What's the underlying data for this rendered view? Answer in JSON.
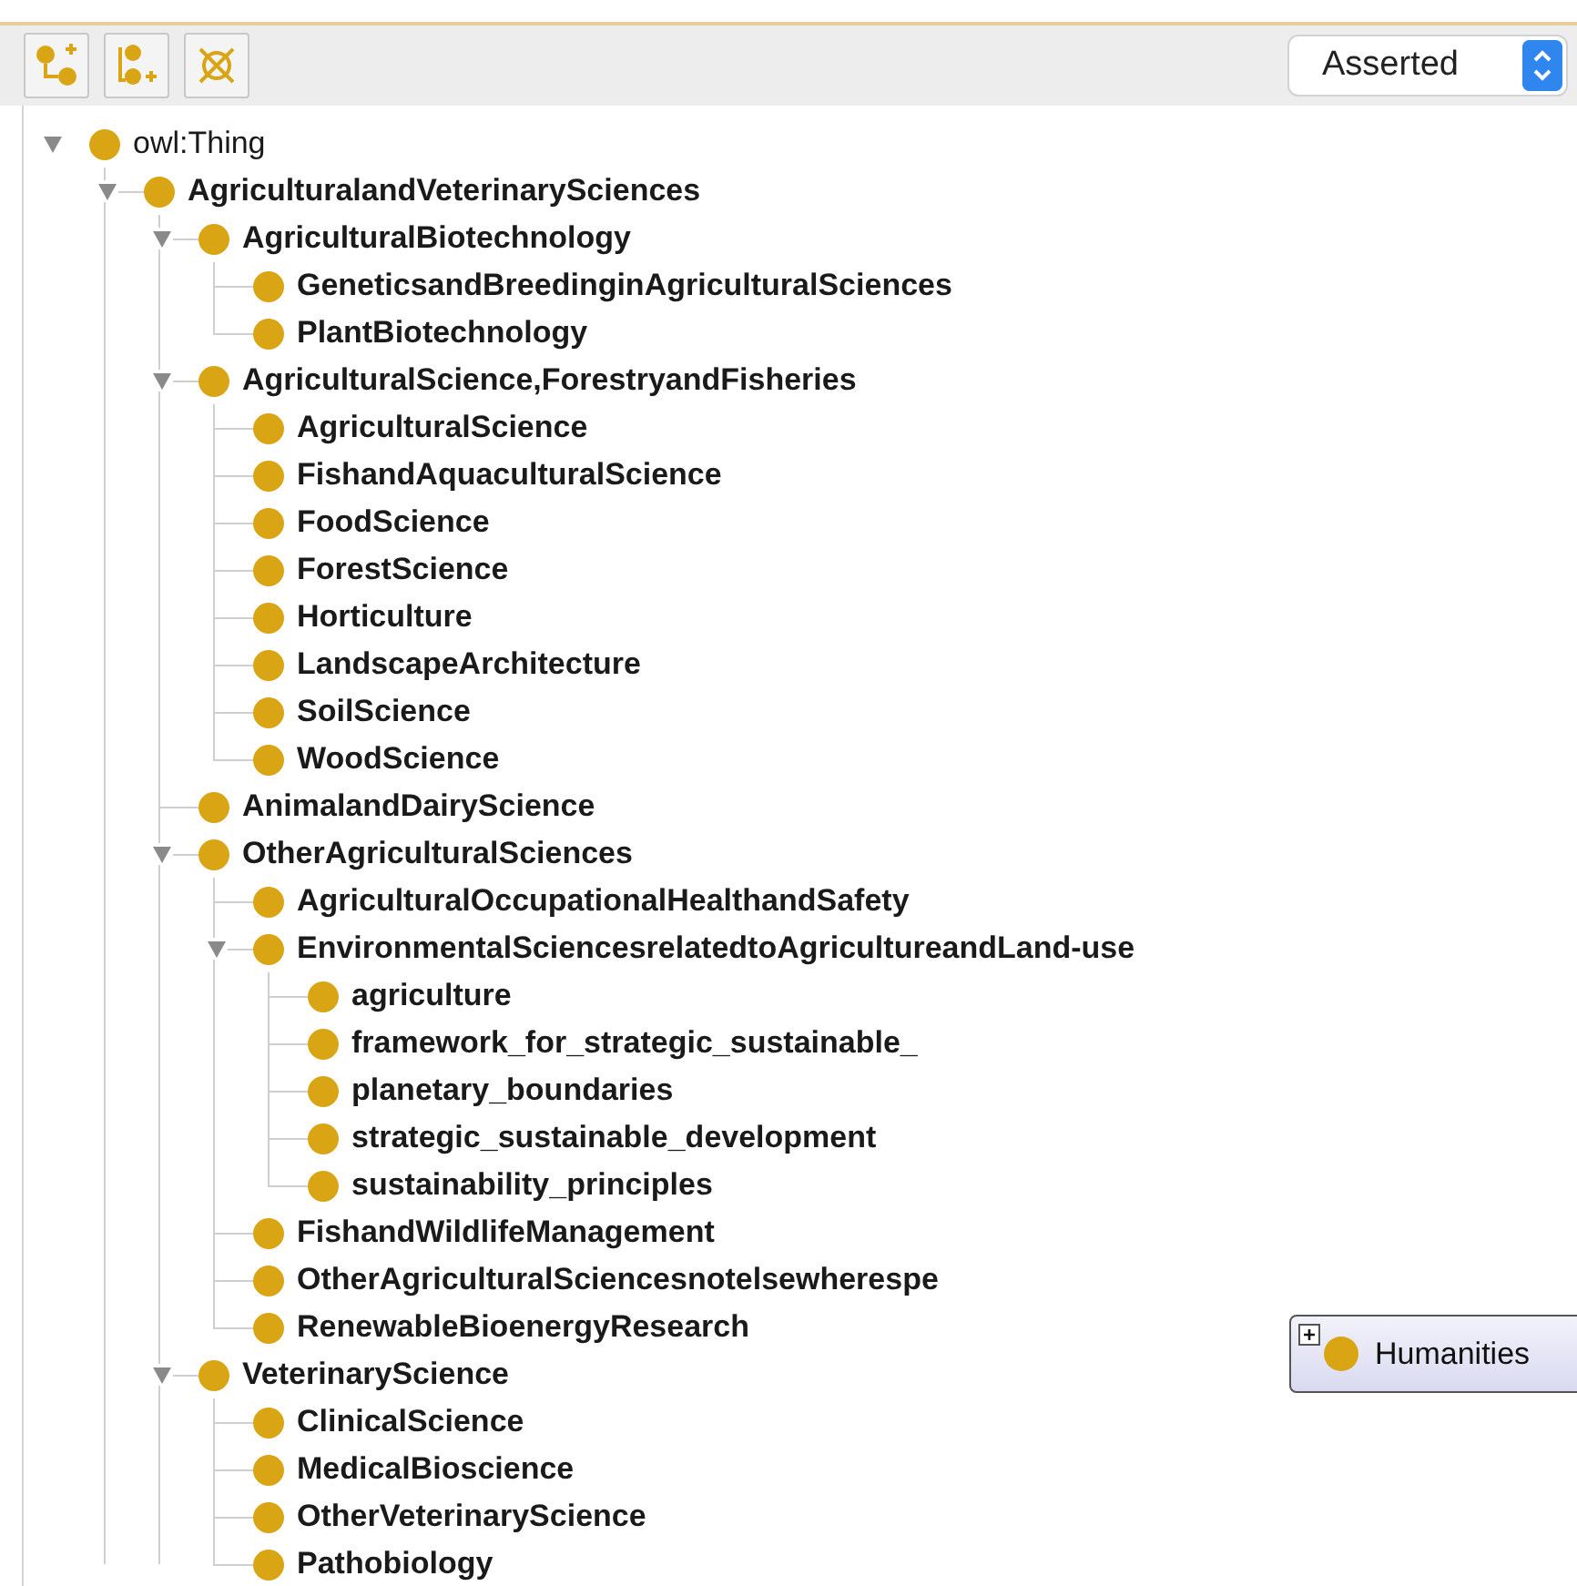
{
  "view_selector": {
    "value": "Asserted"
  },
  "tree": [
    {
      "label": "owl:Thing",
      "expanded": true,
      "children": [
        {
          "label": "AgriculturalandVeterinarySciences",
          "expanded": true,
          "children": [
            {
              "label": "AgriculturalBiotechnology",
              "expanded": true,
              "children": [
                {
                  "label": "GeneticsandBreedinginAgriculturalSciences"
                },
                {
                  "label": "PlantBiotechnology"
                }
              ]
            },
            {
              "label": "AgriculturalScience,ForestryandFisheries",
              "expanded": true,
              "children": [
                {
                  "label": "AgriculturalScience"
                },
                {
                  "label": "FishandAquaculturalScience"
                },
                {
                  "label": "FoodScience"
                },
                {
                  "label": "ForestScience"
                },
                {
                  "label": "Horticulture"
                },
                {
                  "label": "LandscapeArchitecture"
                },
                {
                  "label": "SoilScience"
                },
                {
                  "label": "WoodScience"
                }
              ]
            },
            {
              "label": "AnimalandDairyScience"
            },
            {
              "label": "OtherAgriculturalSciences",
              "expanded": true,
              "children": [
                {
                  "label": "AgriculturalOccupationalHealthandSafety"
                },
                {
                  "label": "EnvironmentalSciencesrelatedtoAgricultureandLand-use",
                  "expanded": true,
                  "children": [
                    {
                      "label": "agriculture"
                    },
                    {
                      "label": "framework_for_strategic_sustainable_"
                    },
                    {
                      "label": "planetary_boundaries"
                    },
                    {
                      "label": "strategic_sustainable_development"
                    },
                    {
                      "label": "sustainability_principles"
                    }
                  ]
                },
                {
                  "label": "FishandWildlifeManagement"
                },
                {
                  "label": "OtherAgriculturalSciencesnotelsewherespe"
                },
                {
                  "label": "RenewableBioenergyResearch"
                }
              ]
            },
            {
              "label": "VeterinaryScience",
              "expanded": true,
              "children": [
                {
                  "label": "ClinicalScience"
                },
                {
                  "label": "MedicalBioscience"
                },
                {
                  "label": "OtherVeterinaryScience"
                },
                {
                  "label": "Pathobiology"
                }
              ]
            }
          ]
        }
      ]
    }
  ],
  "graph_node": {
    "label": "Humanities",
    "expanded": false
  }
}
